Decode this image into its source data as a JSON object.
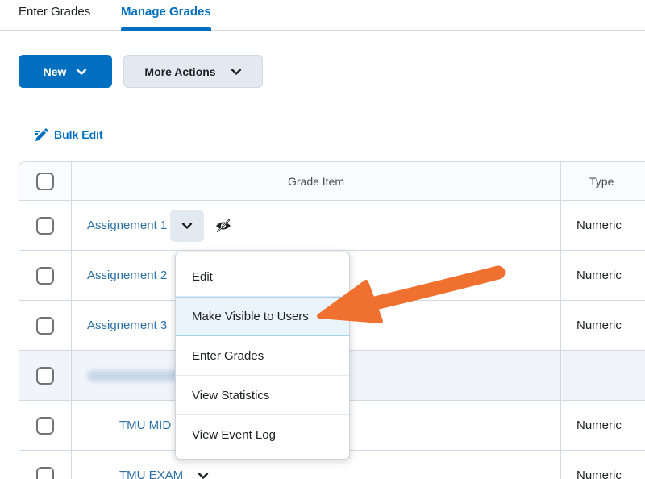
{
  "tabs": [
    {
      "label": "Enter Grades"
    },
    {
      "label": "Manage Grades"
    }
  ],
  "toolbar": {
    "new_label": "New",
    "more_label": "More Actions",
    "bulk_edit_label": "Bulk Edit"
  },
  "table": {
    "headers": {
      "item": "Grade Item",
      "type": "Type"
    },
    "rows": [
      {
        "name": "Assignement 1",
        "type": "Numeric"
      },
      {
        "name": "Assignement 2",
        "type": "Numeric"
      },
      {
        "name": "Assignement 3",
        "type": "Numeric"
      },
      {
        "name": "",
        "type": ""
      },
      {
        "name": "TMU MID",
        "type": "Numeric"
      },
      {
        "name": "TMU EXAM",
        "type": "Numeric"
      }
    ]
  },
  "context_menu": {
    "items": [
      "Edit",
      "Make Visible to Users",
      "Enter Grades",
      "View Statistics",
      "View Event Log"
    ],
    "highlighted": "Make Visible to Users"
  },
  "colors": {
    "primary": "#006fbf",
    "link": "#2b70a8",
    "annotation_arrow": "#f07030"
  },
  "icons": [
    "chevron-down-icon",
    "bulk-edit-icon",
    "eye-hidden-icon"
  ]
}
